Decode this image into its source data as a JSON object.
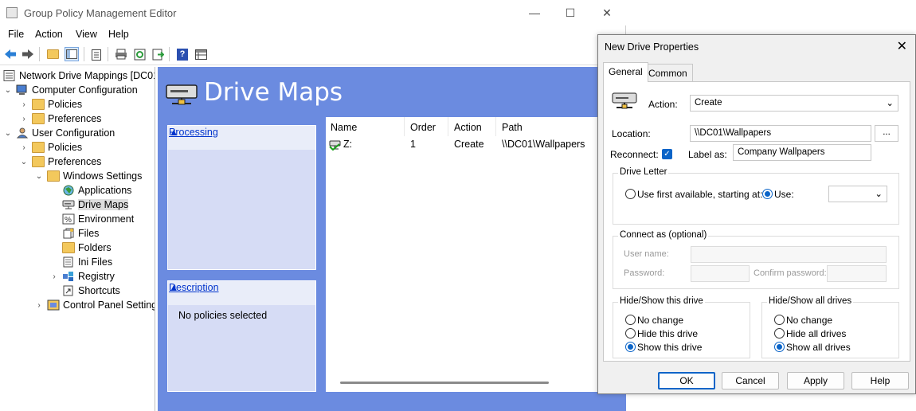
{
  "window": {
    "title": "Group Policy Management Editor",
    "minimize": "—",
    "maximize": "☐",
    "close": "✕"
  },
  "menu": [
    "File",
    "Action",
    "View",
    "Help"
  ],
  "tree": {
    "root": "Network Drive Mappings [DC01",
    "computer_config": "Computer Configuration",
    "policies": "Policies",
    "preferences": "Preferences",
    "user_config": "User Configuration",
    "windows_settings": "Windows Settings",
    "applications": "Applications",
    "drive_maps": "Drive Maps",
    "environment": "Environment",
    "files": "Files",
    "folders": "Folders",
    "ini_files": "Ini Files",
    "registry": "Registry",
    "shortcuts": "Shortcuts",
    "control_panel": "Control Panel Setting"
  },
  "content": {
    "title": "Drive Maps",
    "processing": "Processing",
    "description": "Description",
    "no_policies": "No policies selected",
    "columns": [
      "Name",
      "Order",
      "Action",
      "Path"
    ],
    "row": {
      "name": "Z:",
      "order": "1",
      "action": "Create",
      "path": "\\\\DC01\\Wallpapers"
    }
  },
  "dialog": {
    "title": "New Drive Properties",
    "close": "✕",
    "tabs": [
      "General",
      "Common"
    ],
    "action_label": "Action:",
    "action_value": "Create",
    "location_label": "Location:",
    "location_value": "\\\\DC01\\Wallpapers",
    "browse": "...",
    "reconnect_label": "Reconnect:",
    "label_as_label": "Label as:",
    "label_as_value": "Company Wallpapers",
    "drive_letter_group": "Drive Letter",
    "use_first_available": "Use first available, starting at:",
    "use": "Use:",
    "use_value": "",
    "connect_as_group": "Connect as (optional)",
    "user_name": "User name:",
    "password": "Password:",
    "confirm_password": "Confirm password:",
    "hide_show_this": "Hide/Show this drive",
    "no_change": "No change",
    "hide_this_drive": "Hide this drive",
    "show_this_drive": "Show this drive",
    "hide_show_all": "Hide/Show all drives",
    "no_change_all": "No change",
    "hide_all_drives": "Hide all drives",
    "show_all_drives": "Show all drives",
    "ok": "OK",
    "cancel": "Cancel",
    "apply": "Apply",
    "help": "Help"
  },
  "colors": {
    "content_bg": "#6b8be0",
    "panel_bg": "#d6dcf5",
    "accent": "#0a64c8",
    "link": "#0033cc"
  }
}
